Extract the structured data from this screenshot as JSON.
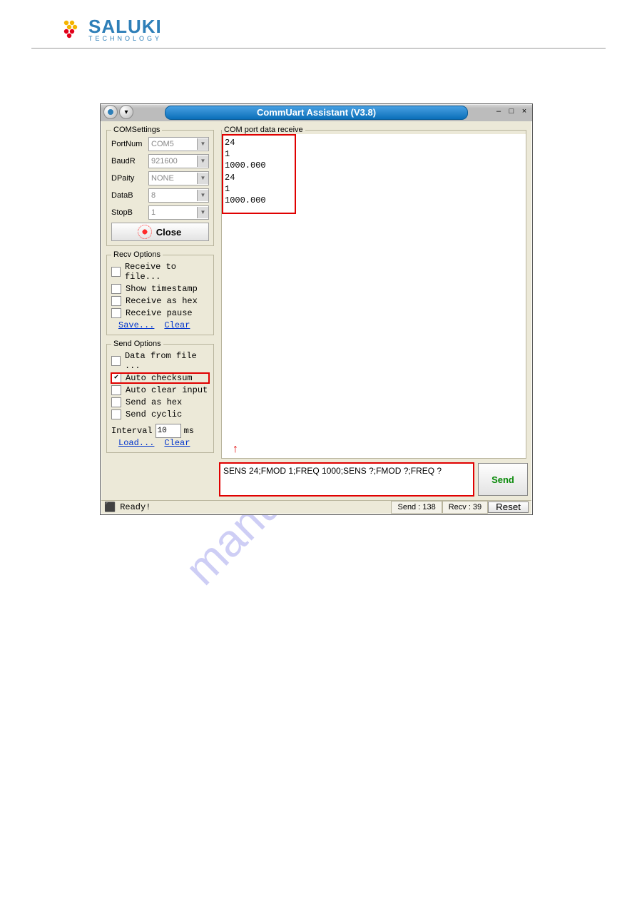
{
  "brand": {
    "name": "SALUKI",
    "tagline": "TECHNOLOGY"
  },
  "watermark": "manualshive.com",
  "window": {
    "title": "CommUart Assistant (V3.8)",
    "min": "–",
    "max": "□",
    "close": "×",
    "menu_down": "▾"
  },
  "com_settings": {
    "legend": "COMSettings",
    "portnum_label": "PortNum",
    "portnum": "COM5",
    "baud_label": "BaudR",
    "baud": "921600",
    "parity_label": "DPaity",
    "parity": "NONE",
    "datab_label": "DataB",
    "datab": "8",
    "stopb_label": "StopB",
    "stopb": "1",
    "close_label": "Close"
  },
  "recv_options": {
    "legend": "Recv Options",
    "receive_to_file": "Receive to file...",
    "show_timestamp": "Show timestamp",
    "receive_as_hex": "Receive as hex",
    "receive_pause": "Receive pause",
    "save": "Save...",
    "clear": "Clear"
  },
  "send_options": {
    "legend": "Send Options",
    "data_from_file": "Data from file ...",
    "auto_checksum": "Auto checksum",
    "auto_checksum_checked": true,
    "auto_clear_input": "Auto clear input",
    "send_as_hex": "Send as hex",
    "send_cyclic": "Send cyclic",
    "interval_label": "Interval",
    "interval_value": "10",
    "interval_unit": "ms",
    "load": "Load...",
    "clear": "Clear"
  },
  "receive": {
    "legend": "COM port data receive",
    "lines": [
      "24",
      "1",
      "1000.000",
      "24",
      "1",
      "1000.000"
    ]
  },
  "send": {
    "input": "SENS 24;FMOD 1;FREQ 1000;SENS ?;FMOD ?;FREQ ?",
    "button": "Send"
  },
  "status": {
    "ready": "Ready!",
    "send": "Send : 138",
    "recv": "Recv : 39",
    "reset": "Reset"
  }
}
